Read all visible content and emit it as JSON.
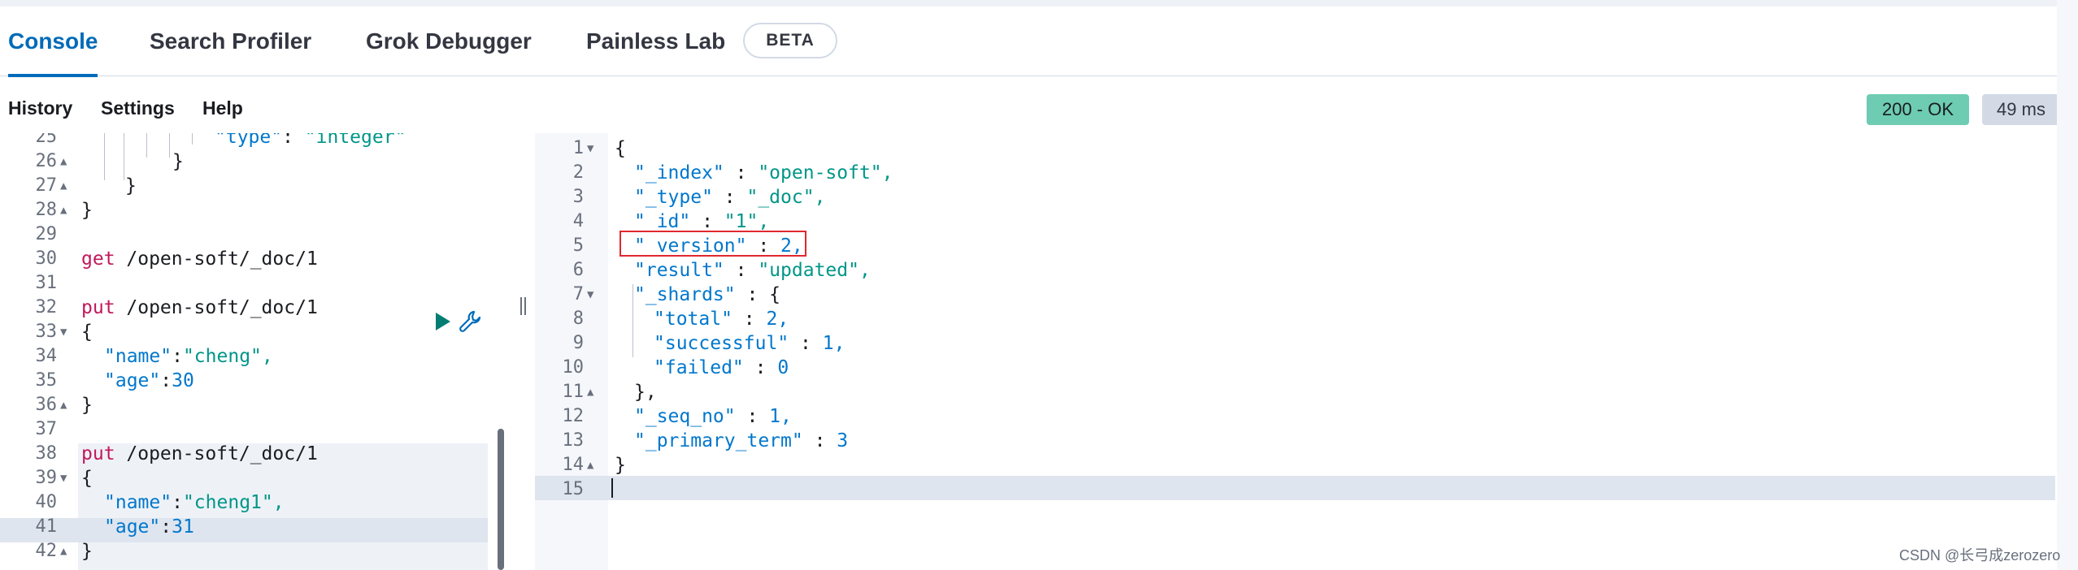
{
  "tabs": {
    "console": "Console",
    "search_profiler": "Search Profiler",
    "grok_debugger": "Grok Debugger",
    "painless_lab": "Painless Lab",
    "beta_badge": "BETA"
  },
  "toolbar": {
    "history": "History",
    "settings": "Settings",
    "help": "Help"
  },
  "status": {
    "code": "200 - OK",
    "time": "49 ms",
    "ok_color": "#6dccb1"
  },
  "request_editor": {
    "lines": [
      {
        "n": "25",
        "fold": "",
        "text": "\"type\": \"integer\""
      },
      {
        "n": "26",
        "fold": "▲",
        "text": "}"
      },
      {
        "n": "27",
        "fold": "▲",
        "text": "}"
      },
      {
        "n": "28",
        "fold": "▲",
        "text": "}"
      },
      {
        "n": "29",
        "fold": "",
        "text": ""
      },
      {
        "n": "30",
        "fold": "",
        "method": "get",
        "path": " /open-soft/_doc/1"
      },
      {
        "n": "31",
        "fold": "",
        "text": ""
      },
      {
        "n": "32",
        "fold": "",
        "method": "put",
        "path": " /open-soft/_doc/1"
      },
      {
        "n": "33",
        "fold": "▼",
        "text": "{"
      },
      {
        "n": "34",
        "fold": "",
        "key": "\"name\"",
        "sep": ":",
        "val": "\"cheng\","
      },
      {
        "n": "35",
        "fold": "",
        "key": "\"age\"",
        "sep": ":",
        "val": "30"
      },
      {
        "n": "36",
        "fold": "▲",
        "text": "}"
      },
      {
        "n": "37",
        "fold": "",
        "text": ""
      },
      {
        "n": "38",
        "fold": "",
        "method": "put",
        "path": " /open-soft/_doc/1"
      },
      {
        "n": "39",
        "fold": "▼",
        "text": "{"
      },
      {
        "n": "40",
        "fold": "",
        "key": "\"name\"",
        "sep": ":",
        "val": "\"cheng1\","
      },
      {
        "n": "41",
        "fold": "",
        "key": "\"age\"",
        "sep": ":",
        "val": "31"
      },
      {
        "n": "42",
        "fold": "▲",
        "text": "}"
      }
    ]
  },
  "response_editor": {
    "lines": [
      {
        "n": "1",
        "fold": "▼",
        "text": "{"
      },
      {
        "n": "2",
        "fold": "",
        "key": "\"_index\"",
        "sep": " : ",
        "val": "\"open-soft\","
      },
      {
        "n": "3",
        "fold": "",
        "key": "\"_type\"",
        "sep": " : ",
        "val": "\"_doc\","
      },
      {
        "n": "4",
        "fold": "",
        "key": "\"_id\"",
        "sep": " : ",
        "val": "\"1\","
      },
      {
        "n": "5",
        "fold": "",
        "key": "\"_version\"",
        "sep": " : ",
        "val": "2,"
      },
      {
        "n": "6",
        "fold": "",
        "key": "\"result\"",
        "sep": " : ",
        "val": "\"updated\","
      },
      {
        "n": "7",
        "fold": "▼",
        "key": "\"_shards\"",
        "sep": " : ",
        "val": "{"
      },
      {
        "n": "8",
        "fold": "",
        "key": "\"total\"",
        "sep": " : ",
        "val": "2,"
      },
      {
        "n": "9",
        "fold": "",
        "key": "\"successful\"",
        "sep": " : ",
        "val": "1,"
      },
      {
        "n": "10",
        "fold": "",
        "key": "\"failed\"",
        "sep": " : ",
        "val": "0"
      },
      {
        "n": "11",
        "fold": "▲",
        "text": "},"
      },
      {
        "n": "12",
        "fold": "",
        "key": "\"_seq_no\"",
        "sep": " : ",
        "val": "1,"
      },
      {
        "n": "13",
        "fold": "",
        "key": "\"_primary_term\"",
        "sep": " : ",
        "val": "3"
      },
      {
        "n": "14",
        "fold": "▲",
        "text": "}"
      },
      {
        "n": "15",
        "fold": "",
        "text": ""
      }
    ]
  },
  "icons": {
    "run": "play-icon",
    "copy_as": "wrench-icon"
  },
  "watermark": "CSDN @长弓成zerozero"
}
